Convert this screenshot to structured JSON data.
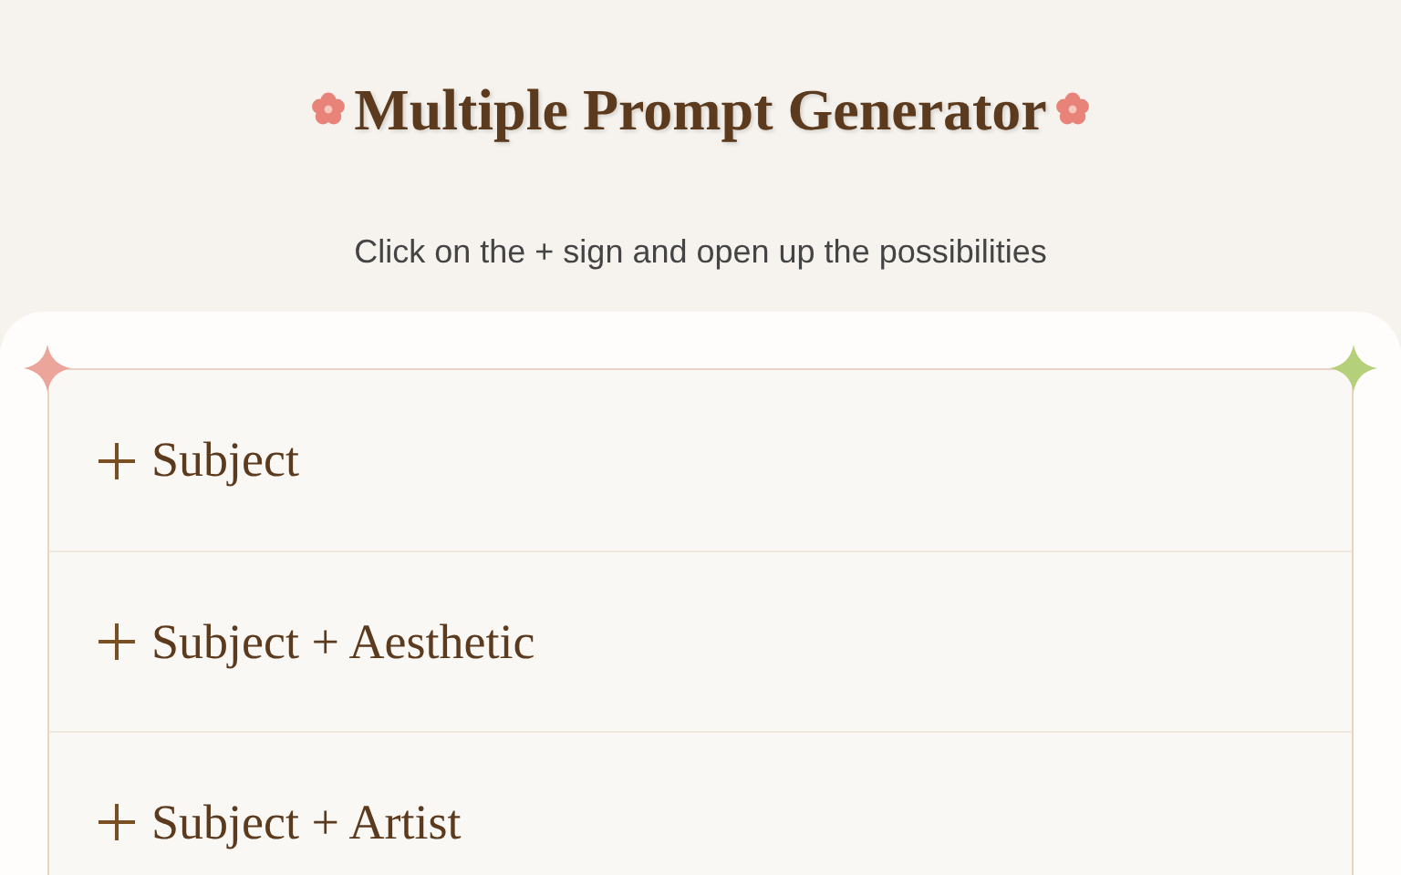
{
  "header": {
    "title": "Multiple Prompt Generator",
    "subtitle": "Click on the + sign and open up the possibilities"
  },
  "accordion": [
    {
      "label": "Subject",
      "expanded": false
    },
    {
      "label": "Subject + Aesthetic",
      "expanded": false
    },
    {
      "label": "Subject + Artist",
      "expanded": false
    }
  ]
}
